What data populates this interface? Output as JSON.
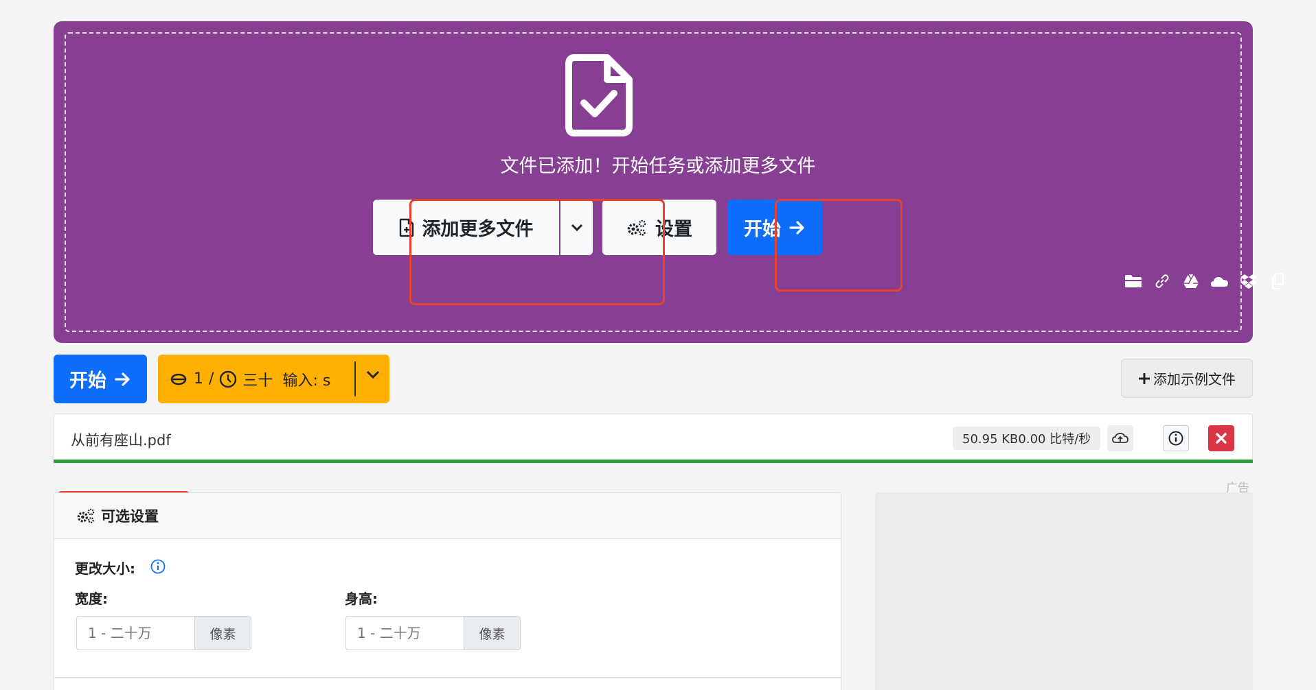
{
  "dropzone": {
    "message": "文件已添加！开始任务或添加更多文件",
    "add_more_label": "添加更多文件",
    "settings_label": "设置",
    "start_label": "开始"
  },
  "cloud_icons": [
    "folder-icon",
    "link-icon",
    "google-drive-icon",
    "onedrive-icon",
    "dropbox-icon",
    "clipboard-icon"
  ],
  "toolbar": {
    "start_label": "开始",
    "credits_count": "1",
    "credits_time": "三十",
    "credits_input": "输入: s",
    "add_sample_label": "添加示例文件"
  },
  "file": {
    "name": "从前有座山.pdf",
    "size_speed": "50.95 KB0.00 比特/秒"
  },
  "settings": {
    "title": "可选设置",
    "resize_label": "更改大小:",
    "width_label": "宽度:",
    "height_label": "身高:",
    "width_placeholder": "1 - 二十万",
    "height_placeholder": "1 - 二十万",
    "unit": "像素"
  },
  "ad": {
    "label": "广告"
  },
  "colors": {
    "dropzone": "#873f94",
    "primary": "#0d6efd",
    "warning": "#ffb000",
    "danger": "#dc3545",
    "success": "#2a9d3a",
    "highlight": "#e8412c"
  }
}
